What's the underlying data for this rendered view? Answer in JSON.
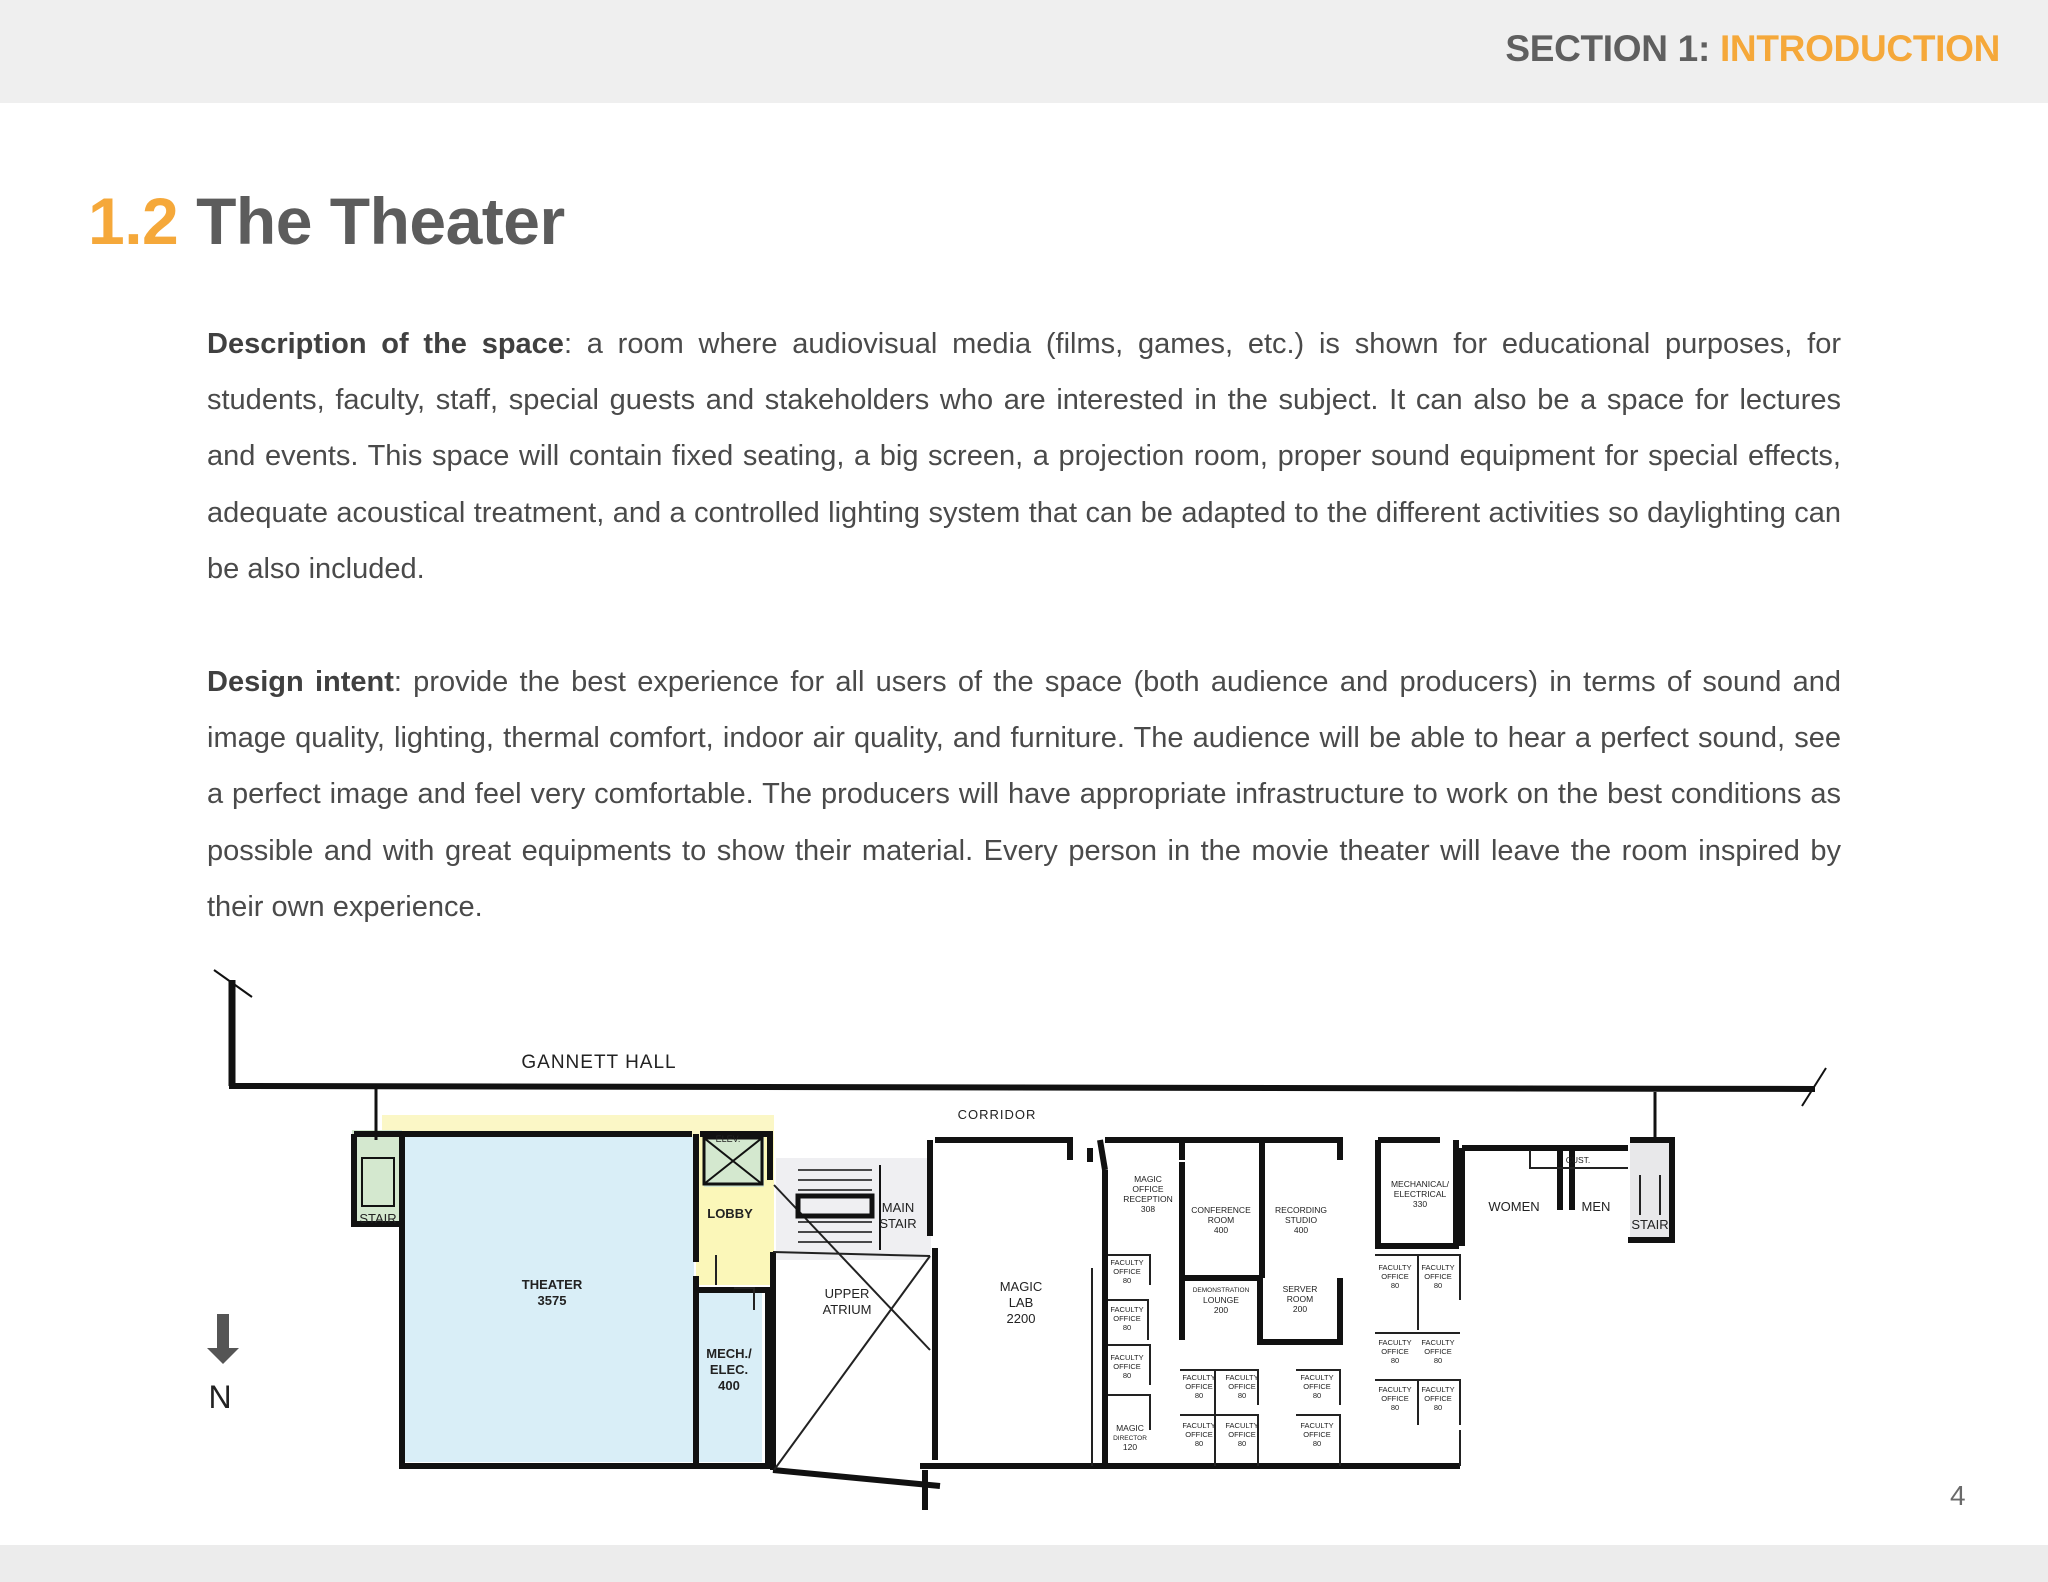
{
  "header": {
    "section_prefix": "SECTION 1: ",
    "section_name": "INTRODUCTION"
  },
  "title": {
    "number": "1.2",
    "text": "The Theater"
  },
  "description": {
    "label": "Description of the space",
    "body": ": a room where audiovisual media (films, games, etc.) is shown for educational purposes, for students, faculty, staff, special guests and stakeholders who are interested in the subject. It can also be a space for lectures and events. This space will contain fixed seating, a big screen, a projection room, proper sound equipment for special effects, adequate acoustical treatment, and a controlled lighting system that can be adapted to the different activities so daylighting can be also included."
  },
  "design_intent": {
    "label": "Design intent",
    "body": ": provide the best experience for all users of the space (both audience and producers) in terms of sound and image quality, lighting, thermal comfort, indoor air quality, and furniture. The audience will be able to hear a perfect sound, see a perfect image and feel very comfortable. The producers will have appropriate infrastructure to work on the best conditions as possible and with great equipments to show their material. Every person in the movie theater will leave the room inspired by their own experience."
  },
  "floor_plan": {
    "gannett_hall": "GANNETT HALL",
    "corridor": "CORRIDOR",
    "stair_left": "STAIR",
    "elev": "ELEV.",
    "lobby": "LOBBY",
    "theater_name": "THEATER",
    "theater_area": "3575",
    "mech_l1": "MECH./",
    "mech_l2": "ELEC.",
    "mech_l3": "400",
    "main_l1": "MAIN",
    "main_l2": "STAIR",
    "atrium_l1": "UPPER",
    "atrium_l2": "ATRIUM",
    "lab_l1": "MAGIC",
    "lab_l2": "LAB",
    "lab_l3": "2200",
    "reception_l1": "MAGIC",
    "reception_l2": "OFFICE",
    "reception_l3": "RECEPTION",
    "reception_l4": "308",
    "conf_l1": "CONFERENCE",
    "conf_l2": "ROOM",
    "conf_l3": "400",
    "rec_l1": "RECORDING",
    "rec_l2": "STUDIO",
    "rec_l3": "400",
    "demo_l1": "DEMONSTRATION",
    "demo_l2": "LOUNGE",
    "demo_l3": "200",
    "server_l1": "SERVER",
    "server_l2": "ROOM",
    "server_l3": "200",
    "me_l1": "MECHANICAL/",
    "me_l2": "ELECTRICAL",
    "me_l3": "330",
    "cust": "CUST.",
    "women": "WOMEN",
    "men": "MEN",
    "stair_right": "STAIR",
    "faculty_l1": "FACULTY",
    "faculty_l2": "OFFICE",
    "faculty_area": "80",
    "director_l1": "MAGIC",
    "director_l2": "DIRECTOR",
    "director_l3": "120",
    "north": "N"
  },
  "page_number": "4",
  "colors": {
    "accent": "#f5a83a",
    "theater_fill": "#d9eef7",
    "lobby_fill": "#fbf7b9",
    "stair_fill": "#d4e8cf"
  }
}
